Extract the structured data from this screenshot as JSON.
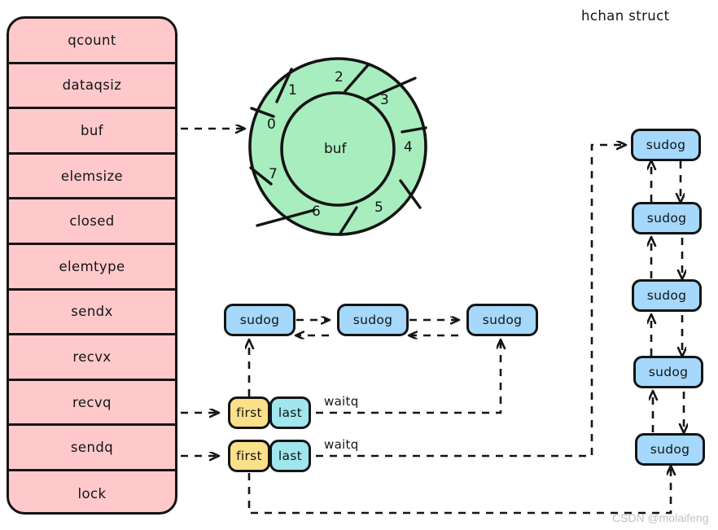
{
  "title": "hchan struct",
  "watermark": "CSDN @molaifeng",
  "colors": {
    "struct_fill": "#ffc9cc",
    "buffer_fill": "#a8edbe",
    "sudog_fill": "#a5d8fb",
    "first_fill": "#fbe08a",
    "last_fill": "#9fe6ef",
    "stroke": "#141414",
    "background": "#ffffff",
    "watermark_text": "#c2c2c2"
  },
  "struct": {
    "name": "hchan",
    "fields": [
      {
        "label": "qcount"
      },
      {
        "label": "dataqsiz"
      },
      {
        "label": "buf"
      },
      {
        "label": "elemsize"
      },
      {
        "label": "closed"
      },
      {
        "label": "elemtype"
      },
      {
        "label": "sendx"
      },
      {
        "label": "recvx"
      },
      {
        "label": "recvq"
      },
      {
        "label": "sendq"
      },
      {
        "label": "lock"
      }
    ]
  },
  "buffer": {
    "center_label": "buf",
    "slot_count": 8,
    "slots": [
      {
        "label": "0"
      },
      {
        "label": "1"
      },
      {
        "label": "2"
      },
      {
        "label": "3"
      },
      {
        "label": "4"
      },
      {
        "label": "5"
      },
      {
        "label": "6"
      },
      {
        "label": "7"
      }
    ]
  },
  "recvq": {
    "first_label": "first",
    "last_label": "last",
    "waitq_label": "waitq",
    "sudogs": [
      {
        "label": "sudog"
      },
      {
        "label": "sudog"
      },
      {
        "label": "sudog"
      }
    ]
  },
  "sendq": {
    "first_label": "first",
    "last_label": "last",
    "waitq_label": "waitq",
    "sudogs": [
      {
        "label": "sudog"
      },
      {
        "label": "sudog"
      },
      {
        "label": "sudog"
      },
      {
        "label": "sudog"
      },
      {
        "label": "sudog"
      }
    ]
  }
}
